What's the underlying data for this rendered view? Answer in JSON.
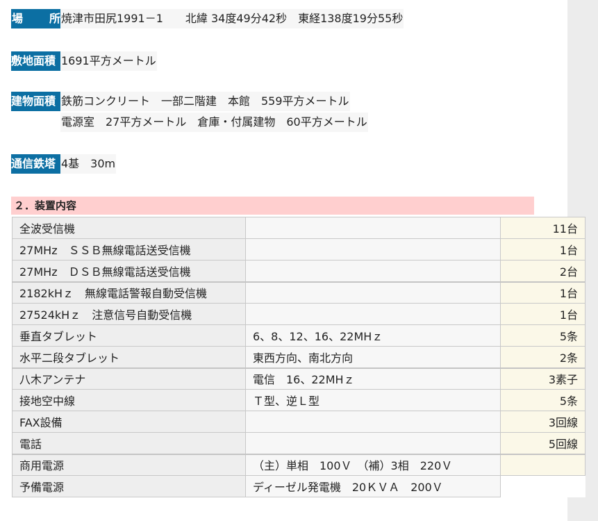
{
  "site_info": {
    "location": {
      "label_a": "場",
      "label_b": "所",
      "values": [
        "焼津市田尻1991－1　　北緯 34度49分42秒　東経138度19分55秒"
      ]
    },
    "site_area": {
      "label": "敷地面積",
      "values": [
        "1691平方メートル"
      ]
    },
    "building_area": {
      "label": "建物面積",
      "values": [
        "鉄筋コンクリート　一部二階建　本館　559平方メートル",
        "電源室　27平方メートル　倉庫・付属建物　60平方メートル"
      ]
    },
    "towers": {
      "label": "通信鉄塔",
      "values": [
        "4基　30m"
      ]
    }
  },
  "equipment_section": {
    "heading": "２．装置内容",
    "rows": [
      {
        "name": "全波受信機",
        "spec": "",
        "qty": "11台"
      },
      {
        "name": "27MHz　ＳＳＢ無線電話送受信機",
        "spec": "",
        "qty": "1台"
      },
      {
        "name": "27MHz　ＤＳＢ無線電話送受信機",
        "spec": "",
        "qty": "2台"
      },
      {
        "name": "2182kHｚ　無線電話警報自動受信機",
        "spec": "",
        "qty": "1台"
      },
      {
        "name": "27524kHｚ　注意信号自動受信機",
        "spec": "",
        "qty": "1台"
      },
      {
        "name": "垂直タブレット",
        "spec": "6、8、12、16、22MHｚ",
        "qty": "5条"
      },
      {
        "name": "水平二段タブレット",
        "spec": "東西方向、南北方向",
        "qty": "2条"
      },
      {
        "name": "八木アンテナ",
        "spec": "電信　16、22MHｚ",
        "qty": "3素子"
      },
      {
        "name": "接地空中線",
        "spec": "Ｔ型、逆Ｌ型",
        "qty": "5条"
      },
      {
        "name": "FAX設備",
        "spec": "",
        "qty": "3回線"
      },
      {
        "name": "電話",
        "spec": "",
        "qty": "5回線"
      },
      {
        "name": "商用電源",
        "spec": "（主）単相　100Ｖ　（補）3相　220Ｖ",
        "qty": ""
      },
      {
        "name": "予備電源",
        "spec": "ディーゼル発電機　20ＫＶＡ　200Ｖ",
        "qty": ""
      }
    ]
  }
}
